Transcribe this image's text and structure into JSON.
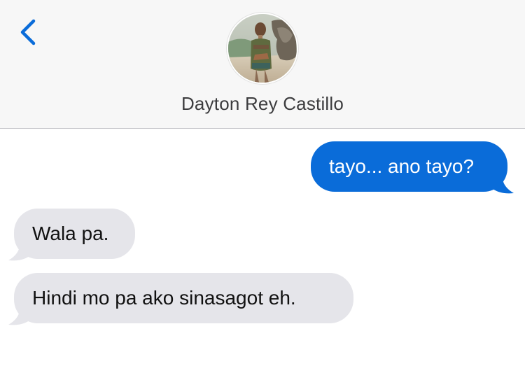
{
  "header": {
    "back_icon": "chevron-left-icon",
    "contact_name": "Dayton Rey Castillo",
    "avatar_icon": "contact-photo"
  },
  "messages": [
    {
      "direction": "sent",
      "text": "tayo... ano tayo?"
    },
    {
      "direction": "received",
      "text": "Wala pa."
    },
    {
      "direction": "received",
      "text": "Hindi mo pa ako sinasagot eh."
    }
  ],
  "colors": {
    "accent": "#0a6cd9",
    "sent_bubble": "#0a6cd9",
    "received_bubble": "#e5e5ea",
    "header_bg": "#f7f7f7"
  }
}
